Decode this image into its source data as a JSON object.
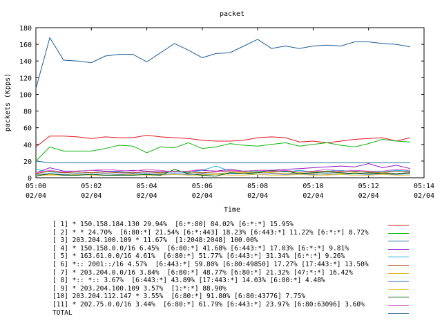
{
  "chart_data": {
    "type": "line",
    "title": "packet",
    "xlabel": "Time",
    "ylabel": "packets (Kpps)",
    "ylim": [
      0,
      180
    ],
    "yticks": [
      "0",
      "20",
      "40",
      "60",
      "80",
      "100",
      "120",
      "140",
      "160",
      "180"
    ],
    "xlim": [
      "05:00",
      "05:14"
    ],
    "xticks": [
      {
        "time": "05:00",
        "date": "02/04"
      },
      {
        "time": "05:02",
        "date": "02/04"
      },
      {
        "time": "05:04",
        "date": "02/04"
      },
      {
        "time": "05:06",
        "date": "02/04"
      },
      {
        "time": "05:08",
        "date": "02/04"
      },
      {
        "time": "05:10",
        "date": "02/04"
      },
      {
        "time": "05:12",
        "date": "02/04"
      },
      {
        "time": "05:14",
        "date": "02/04"
      }
    ],
    "x": [
      "05:00",
      "05:00:30",
      "05:01",
      "05:01:30",
      "05:02",
      "05:02:30",
      "05:03",
      "05:03:30",
      "05:04",
      "05:04:30",
      "05:05",
      "05:05:30",
      "05:06",
      "05:06:30",
      "05:07",
      "05:07:30",
      "05:08",
      "05:08:30",
      "05:09",
      "05:09:30",
      "05:10",
      "05:10:30",
      "05:11",
      "05:11:30",
      "05:12",
      "05:12:30",
      "05:13",
      "05:13:30"
    ],
    "series": [
      {
        "name": "[ 1] * 150.158.184.130 29.94%  [6:*:80] 84.02% [6:*:*] 15.95%",
        "color": "#e0141c",
        "values": [
          37,
          50,
          50,
          49,
          47,
          49,
          48,
          48,
          51,
          49,
          48,
          47,
          45,
          44,
          44,
          45,
          48,
          49,
          48,
          43,
          44,
          42,
          44,
          46,
          47,
          48,
          44,
          48
        ]
      },
      {
        "name": "[ 2] * * 24.70%  [6:80:*] 21.54% [6:*:443] 18.23% [6:443:*] 11.22% [6:*:*] 8.72%",
        "color": "#0fb40f",
        "values": [
          20,
          37,
          32,
          32,
          32,
          35,
          39,
          38,
          30,
          37,
          36,
          42,
          35,
          37,
          41,
          39,
          38,
          40,
          42,
          38,
          40,
          42,
          39,
          37,
          41,
          46,
          44,
          43
        ]
      },
      {
        "name": "[ 3] 203.204.100.109 * 11.67%  [1:2048:2048] 100.00%",
        "color": "#1f6ea0",
        "values": [
          20,
          18,
          18,
          18,
          18,
          18,
          18,
          18,
          18,
          18,
          18,
          18,
          18,
          18,
          18,
          18,
          18,
          18,
          18,
          18,
          18,
          18,
          18,
          18,
          18,
          18,
          18,
          18
        ]
      },
      {
        "name": "[ 4] * 150.158.0.0/16 6.45%  [6:80:*] 41.68% [6:443:*] 17.03% [6:*:*] 9.81%",
        "color": "#9014c8",
        "values": [
          6,
          12,
          8,
          8,
          9,
          8,
          8,
          9,
          8,
          8,
          7,
          8,
          9,
          8,
          10,
          8,
          9,
          9,
          10,
          11,
          12,
          13,
          14,
          13,
          17,
          12,
          15,
          11
        ]
      },
      {
        "name": "[ 5] * 163.61.0.0/16 4.61%  [6:80:*] 51.77% [6:443:*] 31.34% [6:*:*] 9.26%",
        "color": "#17b4dc",
        "values": [
          10,
          7,
          6,
          7,
          6,
          7,
          7,
          6,
          7,
          6,
          7,
          6,
          9,
          14,
          8,
          7,
          8,
          8,
          7,
          9,
          7,
          8,
          9,
          7,
          8,
          7,
          9,
          8
        ]
      },
      {
        "name": "[ 6] *:: 2001::/16 4.57%  [6:443:*] 59.80% [6:80:49850] 17.27% [17:443:*] 13.50%",
        "color": "#b45014",
        "values": [
          5,
          8,
          6,
          7,
          6,
          7,
          6,
          6,
          7,
          6,
          8,
          7,
          6,
          7,
          8,
          7,
          6,
          7,
          8,
          7,
          7,
          8,
          7,
          8,
          7,
          6,
          8,
          7
        ]
      },
      {
        "name": "[ 7] * 203.204.0.0/16 3.84%  [6:80:*] 48.77% [6:80:*] 21.32% [47:*:*] 16.42%",
        "color": "#dcb414",
        "values": [
          3,
          4,
          4,
          5,
          4,
          5,
          4,
          3,
          4,
          5,
          4,
          5,
          4,
          5,
          6,
          6,
          7,
          6,
          5,
          6,
          5,
          4,
          5,
          6,
          5,
          6,
          5,
          6
        ]
      },
      {
        "name": "[ 8] *:: *:: 3.67%  [6:443:*] 43.89% [17:443:*] 14.03% [6:80:*] 4.48%",
        "color": "#3264c8",
        "values": [
          4,
          5,
          4,
          5,
          4,
          5,
          4,
          5,
          5,
          4,
          5,
          4,
          5,
          4,
          5,
          5,
          4,
          5,
          4,
          5,
          4,
          5,
          4,
          5,
          4,
          5,
          4,
          5
        ]
      },
      {
        "name": "[ 9] * 203.204.100.109 3.57%  [1:*:*] 88.90%",
        "color": "#ebc84b",
        "values": [
          3,
          3,
          3,
          4,
          3,
          3,
          3,
          4,
          3,
          3,
          4,
          3,
          3,
          4,
          3,
          3,
          4,
          3,
          3,
          4,
          3,
          3,
          4,
          3,
          3,
          4,
          3,
          3
        ]
      },
      {
        "name": "[10] 203.204.112.147 * 3.55%  [6:80:*] 91.80% [6:80:43776] 7.75%",
        "color": "#0a6414",
        "values": [
          2,
          5,
          3,
          3,
          4,
          3,
          3,
          3,
          4,
          3,
          10,
          5,
          3,
          2,
          6,
          5,
          6,
          9,
          8,
          5,
          6,
          7,
          6,
          5,
          6,
          5,
          5,
          6
        ]
      },
      {
        "name": "[11] * 202.75.0.0/16 3.44%  [6:80:*] 61.79% [6:443:*] 23.97% [6:80:63096] 3.60%",
        "color": "#d264d2",
        "values": [
          6,
          9,
          7,
          8,
          9,
          10,
          9,
          8,
          10,
          9,
          7,
          8,
          10,
          7,
          9,
          8,
          9,
          8,
          9,
          7,
          8,
          10,
          8,
          9,
          8,
          8,
          10,
          9
        ]
      },
      {
        "name": "TOTAL",
        "color": "#1c5a96",
        "values": [
          107,
          168,
          141,
          140,
          138,
          146,
          148,
          148,
          139,
          150,
          161,
          153,
          144,
          149,
          150,
          158,
          166,
          155,
          158,
          155,
          158,
          159,
          158,
          163,
          163,
          161,
          160,
          157
        ]
      }
    ],
    "grid": false,
    "legend_position": "bottom"
  }
}
